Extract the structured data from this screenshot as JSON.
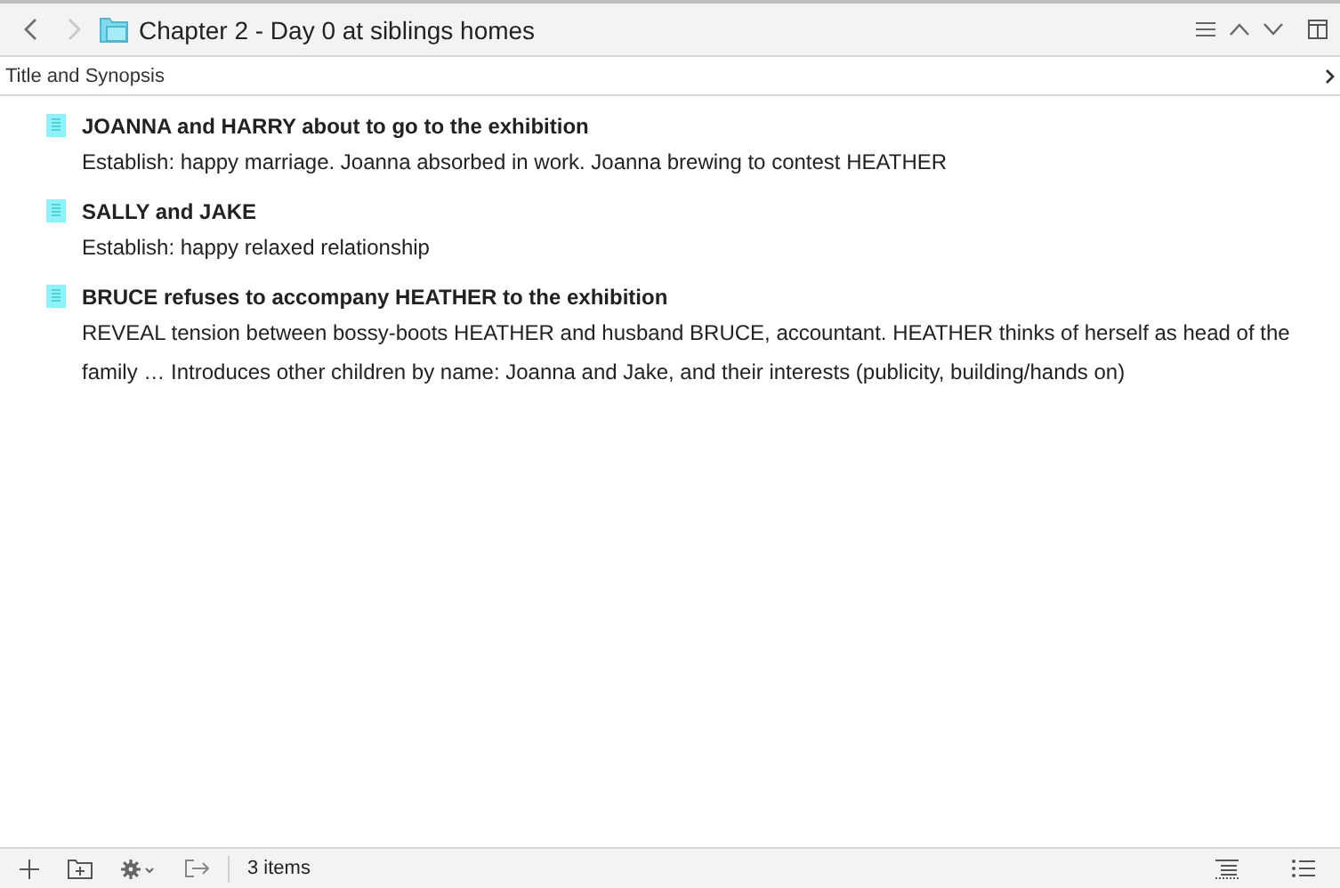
{
  "toolbar": {
    "back_disabled": false,
    "forward_disabled": true,
    "title": "Chapter 2 - Day 0 at siblings homes"
  },
  "header": {
    "label": "Title and Synopsis"
  },
  "documents": [
    {
      "title": "JOANNA and HARRY about to go to the exhibition",
      "synopsis": "Establish: happy marriage. Joanna absorbed in work. Joanna brewing to contest HEATHER"
    },
    {
      "title": "SALLY and JAKE",
      "synopsis": "Establish: happy relaxed relationship"
    },
    {
      "title": "BRUCE refuses to accompany HEATHER to the exhibition",
      "synopsis": "REVEAL tension between bossy-boots HEATHER and husband BRUCE, accountant. HEATHER thinks of herself as head of the family … Introduces other children by name: Joanna and Jake, and their interests (publicity, building/hands on)"
    }
  ],
  "footer": {
    "count": "3 items"
  }
}
